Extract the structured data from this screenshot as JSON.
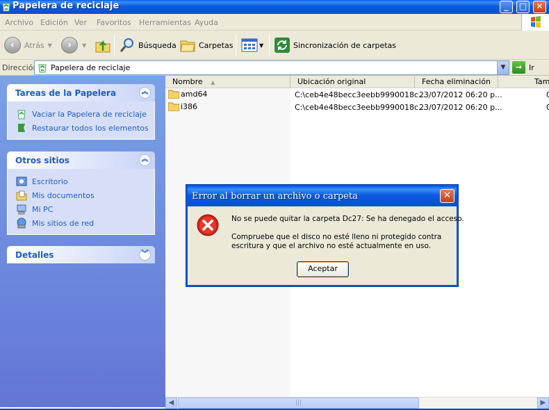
{
  "window": {
    "title": "Papelera de reciclaje",
    "min_label": "_",
    "max_label": "□",
    "close_label": "✕"
  },
  "menu": [
    "Archivo",
    "Edición",
    "Ver",
    "Favoritos",
    "Herramientas",
    "Ayuda"
  ],
  "toolbar": {
    "back_label": "Atrás",
    "search_label": "Búsqueda",
    "folders_label": "Carpetas",
    "sync_label": "Sincronización de carpetas"
  },
  "address": {
    "label": "Dirección",
    "value": "Papelera de reciclaje",
    "go_label": "Ir"
  },
  "taskpane": {
    "tasks": {
      "title": "Tareas de la Papelera",
      "items": [
        "Vaciar la Papelera de reciclaje",
        "Restaurar todos los elementos"
      ]
    },
    "places": {
      "title": "Otros sitios",
      "items": [
        "Escritorio",
        "Mis documentos",
        "Mi PC",
        "Mis sitios de red"
      ]
    },
    "details": {
      "title": "Detalles"
    }
  },
  "filelist": {
    "columns": [
      "Nombre",
      "Ubicación original",
      "Fecha eliminación",
      "Tam"
    ],
    "rows": [
      {
        "name": "amd64",
        "location": "C:\\ceb4e48becc3eebb9990018c...",
        "date": "23/07/2012 06:20 p...",
        "size": "0"
      },
      {
        "name": "i386",
        "location": "C:\\ceb4e48becc3eebb9990018c...",
        "date": "23/07/2012 06:20 p...",
        "size": "0"
      }
    ]
  },
  "dialog": {
    "title": "Error al borrar un archivo o carpeta",
    "message1": "No se puede quitar la carpeta Dc27: Se ha denegado el acceso.",
    "message2": "Compruebe que el disco no esté lleno ni protegido contra escritura y que el archivo no esté actualmente en uso.",
    "ok_label": "Aceptar",
    "close_label": "✕"
  },
  "colors": {
    "titlebar": "#0550d6",
    "taskpane_link": "#215dc6",
    "error_red": "#d4201a"
  }
}
